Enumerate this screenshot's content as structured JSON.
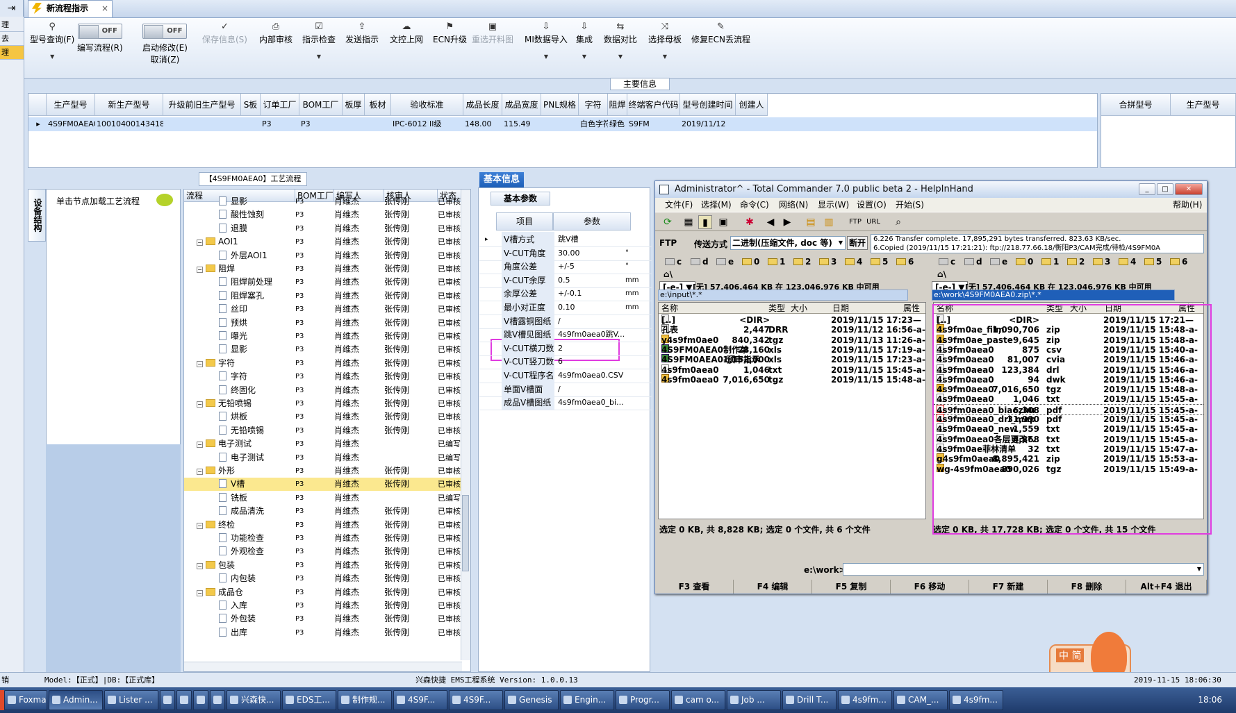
{
  "tab_title": "新流程指示",
  "toolbar": {
    "query": "型号查询(F)",
    "write": "编写流程(R)",
    "start": "启动修改(E)",
    "cancel": "取消(Z)",
    "off1": "OFF",
    "off2": "OFF",
    "save": "保存信息(S)",
    "review": "内部审核",
    "check": "指示检查",
    "send": "发送指示",
    "upload": "文控上网",
    "ecn": "ECN升级",
    "reselect": "重选开料图",
    "mi_import": "MI数据导入",
    "integrate": "集成",
    "compare": "数据对比",
    "select_board": "选择母板",
    "fix_ecn": "修复ECN丢流程"
  },
  "main_info_label": "主要信息",
  "top_grid": {
    "headers": [
      "生产型号",
      "新生产型号",
      "升级前旧生产型号",
      "S板",
      "订单工厂",
      "BOM工厂",
      "板厚",
      "板材",
      "验收标准",
      "成品长度",
      "成品宽度",
      "PNL规格",
      "字符",
      "阻焊",
      "终端客户代码",
      "型号创建时间",
      "创建人"
    ],
    "row": [
      "4S9FM0AEA0",
      "10010400143418",
      "",
      "",
      "P3",
      "P3",
      "",
      "",
      "IPC-6012 II级",
      "148.00",
      "115.49",
      "",
      "白色字符",
      "绿色",
      "S9FM",
      "2019/11/12",
      ""
    ],
    "right_headers": [
      "合拼型号",
      "生产型号"
    ]
  },
  "left_panel": {
    "vtab": "设备结构",
    "hint": "单击节点加载工艺流程"
  },
  "proc_title": "【4S9FM0AEA0】工艺流程",
  "tree": {
    "headers": [
      "流程",
      "BOM工厂",
      "编写人",
      "核审人",
      "状态"
    ],
    "rows": [
      {
        "lvl": 2,
        "t": "显影",
        "f": "P3",
        "w": "肖维杰",
        "r": "张传刚",
        "s": "已审核"
      },
      {
        "lvl": 2,
        "t": "酸性蚀刻",
        "f": "P3",
        "w": "肖维杰",
        "r": "张传刚",
        "s": "已审核"
      },
      {
        "lvl": 2,
        "t": "退膜",
        "f": "P3",
        "w": "肖维杰",
        "r": "张传刚",
        "s": "已审核"
      },
      {
        "lvl": 1,
        "t": "AOI1",
        "f": "P3",
        "w": "肖维杰",
        "r": "张传刚",
        "s": "已审核"
      },
      {
        "lvl": 2,
        "t": "外层AOI1",
        "f": "P3",
        "w": "肖维杰",
        "r": "张传刚",
        "s": "已审核"
      },
      {
        "lvl": 1,
        "t": "阻焊",
        "f": "P3",
        "w": "肖维杰",
        "r": "张传刚",
        "s": "已审核"
      },
      {
        "lvl": 2,
        "t": "阻焊前处理",
        "f": "P3",
        "w": "肖维杰",
        "r": "张传刚",
        "s": "已审核"
      },
      {
        "lvl": 2,
        "t": "阻焊塞孔",
        "f": "P3",
        "w": "肖维杰",
        "r": "张传刚",
        "s": "已审核"
      },
      {
        "lvl": 2,
        "t": "丝印",
        "f": "P3",
        "w": "肖维杰",
        "r": "张传刚",
        "s": "已审核"
      },
      {
        "lvl": 2,
        "t": "预烘",
        "f": "P3",
        "w": "肖维杰",
        "r": "张传刚",
        "s": "已审核"
      },
      {
        "lvl": 2,
        "t": "曝光",
        "f": "P3",
        "w": "肖维杰",
        "r": "张传刚",
        "s": "已审核"
      },
      {
        "lvl": 2,
        "t": "显影",
        "f": "P3",
        "w": "肖维杰",
        "r": "张传刚",
        "s": "已审核"
      },
      {
        "lvl": 1,
        "t": "字符",
        "f": "P3",
        "w": "肖维杰",
        "r": "张传刚",
        "s": "已审核"
      },
      {
        "lvl": 2,
        "t": "字符",
        "f": "P3",
        "w": "肖维杰",
        "r": "张传刚",
        "s": "已审核"
      },
      {
        "lvl": 2,
        "t": "终固化",
        "f": "P3",
        "w": "肖维杰",
        "r": "张传刚",
        "s": "已审核"
      },
      {
        "lvl": 1,
        "t": "无铅喷锡",
        "f": "P3",
        "w": "肖维杰",
        "r": "张传刚",
        "s": "已审核"
      },
      {
        "lvl": 2,
        "t": "烘板",
        "f": "P3",
        "w": "肖维杰",
        "r": "张传刚",
        "s": "已审核"
      },
      {
        "lvl": 2,
        "t": "无铅喷锡",
        "f": "P3",
        "w": "肖维杰",
        "r": "张传刚",
        "s": "已审核"
      },
      {
        "lvl": 1,
        "t": "电子测试",
        "f": "P3",
        "w": "肖维杰",
        "r": "",
        "s": "已编写"
      },
      {
        "lvl": 2,
        "t": "电子测试",
        "f": "P3",
        "w": "肖维杰",
        "r": "",
        "s": "已编写"
      },
      {
        "lvl": 1,
        "t": "外形",
        "f": "P3",
        "w": "肖维杰",
        "r": "张传刚",
        "s": "已审核"
      },
      {
        "lvl": 2,
        "t": "V槽",
        "f": "P3",
        "w": "肖维杰",
        "r": "张传刚",
        "s": "已审核",
        "sel": true
      },
      {
        "lvl": 2,
        "t": "铣板",
        "f": "P3",
        "w": "肖维杰",
        "r": "",
        "s": "已编写"
      },
      {
        "lvl": 2,
        "t": "成品清洗",
        "f": "P3",
        "w": "肖维杰",
        "r": "张传刚",
        "s": "已审核"
      },
      {
        "lvl": 1,
        "t": "终检",
        "f": "P3",
        "w": "肖维杰",
        "r": "张传刚",
        "s": "已审核"
      },
      {
        "lvl": 2,
        "t": "功能检查",
        "f": "P3",
        "w": "肖维杰",
        "r": "张传刚",
        "s": "已审核"
      },
      {
        "lvl": 2,
        "t": "外观检查",
        "f": "P3",
        "w": "肖维杰",
        "r": "张传刚",
        "s": "已审核"
      },
      {
        "lvl": 1,
        "t": "包装",
        "f": "P3",
        "w": "肖维杰",
        "r": "张传刚",
        "s": "已审核"
      },
      {
        "lvl": 2,
        "t": "内包装",
        "f": "P3",
        "w": "肖维杰",
        "r": "张传刚",
        "s": "已审核"
      },
      {
        "lvl": 1,
        "t": "成品仓",
        "f": "P3",
        "w": "肖维杰",
        "r": "张传刚",
        "s": "已审核"
      },
      {
        "lvl": 2,
        "t": "入库",
        "f": "P3",
        "w": "肖维杰",
        "r": "张传刚",
        "s": "已审核"
      },
      {
        "lvl": 2,
        "t": "外包装",
        "f": "P3",
        "w": "肖维杰",
        "r": "张传刚",
        "s": "已审核"
      },
      {
        "lvl": 2,
        "t": "出库",
        "f": "P3",
        "w": "肖维杰",
        "r": "张传刚",
        "s": "已审核"
      }
    ]
  },
  "basic": {
    "tab": "基本信息",
    "sub": "基本参数",
    "h_item": "项目",
    "h_param": "参数",
    "rows": [
      {
        "k": "V槽方式",
        "v": "跳V槽",
        "u": ""
      },
      {
        "k": "V-CUT角度",
        "v": "30.00",
        "u": "°"
      },
      {
        "k": "角度公差",
        "v": "+/-5",
        "u": "°"
      },
      {
        "k": "V-CUT余厚",
        "v": "0.5",
        "u": "mm"
      },
      {
        "k": "余厚公差",
        "v": "+/-0.1",
        "u": "mm"
      },
      {
        "k": "最小对正度",
        "v": "0.10",
        "u": "mm"
      },
      {
        "k": "V槽露铜图纸",
        "v": "/",
        "u": ""
      },
      {
        "k": "跳V槽见图纸",
        "v": "4s9fm0aea0跳V...",
        "u": ""
      },
      {
        "k": "V-CUT横刀数",
        "v": "2",
        "u": ""
      },
      {
        "k": "V-CUT竖刀数",
        "v": "6",
        "u": ""
      },
      {
        "k": "V-CUT程序名",
        "v": "4s9fm0aea0.CSV",
        "u": ""
      },
      {
        "k": "单面V槽面",
        "v": "/",
        "u": ""
      },
      {
        "k": "成品V槽图纸",
        "v": "4s9fm0aea0_bi...",
        "u": ""
      }
    ]
  },
  "tc": {
    "title": "Administrator^ - Total Commander 7.0 public beta 2 - HelpInHand",
    "menu": [
      "文件(F)",
      "选择(M)",
      "命令(C)",
      "网络(N)",
      "显示(W)",
      "设置(O)",
      "开始(S)"
    ],
    "help": "帮助(H)",
    "ftp": "FTP",
    "mode_label": "传送方式",
    "mode": "二进制(压缩文件, doc 等)",
    "disconnect": "断开",
    "log1": "6.226 Transfer complete. 17,895,291 bytes transferred. 823.63 KB/sec.",
    "log2": "6.Copied (2019/11/15 17:21:21): ftp://218.77.66.18/衡阳P3/CAM完成/待检/4S9FM0A",
    "drives": [
      "c",
      "d",
      "e",
      "0",
      "1",
      "2",
      "3",
      "4",
      "5",
      "6"
    ],
    "left_drive": "[-e-]",
    "left_free": "[无] 57,406,464 KB 在 123,046,976 KB 中可用",
    "right_drive": "[-e-]",
    "right_free": "[无] 57,406,464 KB 在 123,046,976 KB 中可用",
    "left_path": "e:\\input\\*.*",
    "right_path": "e:\\work\\4S9FM0AEA0.zip\\*.*",
    "cols": [
      "名称",
      "类型",
      "大小",
      "日期",
      "属性"
    ],
    "left_files": [
      {
        "n": "[..]",
        "t": "",
        "s": "<DIR>",
        "d": "2019/11/15 17:23—",
        "i": "up"
      },
      {
        "n": "孔表",
        "t": "DRR",
        "s": "2,447",
        "d": "2019/11/12 16:56-a-",
        "i": ""
      },
      {
        "n": "y4s9fm0ae0",
        "t": "tgz",
        "s": "840,342",
        "d": "2019/11/13 11:26-a-",
        "i": "zip"
      },
      {
        "n": "4S9FM0AEA0制作单",
        "t": "xls",
        "s": "28,160",
        "d": "2019/11/15 17:19-a-",
        "i": "xls"
      },
      {
        "n": "4S9FM0AEA0-预审指示",
        "t": "xls",
        "s": "1,152,000",
        "d": "2019/11/15 17:23-a-",
        "i": "xls"
      },
      {
        "n": "4s9fm0aea0",
        "t": "txt",
        "s": "1,046",
        "d": "2019/11/15 15:45-a-",
        "i": ""
      },
      {
        "n": "4s9fm0aea0",
        "t": "tgz",
        "s": "7,016,650",
        "d": "2019/11/15 15:48-a-",
        "i": "zip"
      }
    ],
    "right_files": [
      {
        "n": "[..]",
        "t": "",
        "s": "<DIR>",
        "d": "2019/11/15 17:21—",
        "i": "up"
      },
      {
        "n": "4s9fm0ae_film",
        "t": "zip",
        "s": "1,090,706",
        "d": "2019/11/15 15:48-a-",
        "i": "zip"
      },
      {
        "n": "4s9fm0ae_paste",
        "t": "zip",
        "s": "9,645",
        "d": "2019/11/15 15:48-a-",
        "i": "zip"
      },
      {
        "n": "4s9fm0aea0",
        "t": "csv",
        "s": "875",
        "d": "2019/11/15 15:40-a-",
        "i": ""
      },
      {
        "n": "4s9fm0aea0",
        "t": "cvia",
        "s": "81,007",
        "d": "2019/11/15 15:46-a-",
        "i": ""
      },
      {
        "n": "4s9fm0aea0",
        "t": "drl",
        "s": "123,384",
        "d": "2019/11/15 15:46-a-",
        "i": ""
      },
      {
        "n": "4s9fm0aea0",
        "t": "dwk",
        "s": "94",
        "d": "2019/11/15 15:46-a-",
        "i": ""
      },
      {
        "n": "4s9fm0aea0",
        "t": "tgz",
        "s": "7,016,650",
        "d": "2019/11/15 15:48-a-",
        "i": "zip"
      },
      {
        "n": "4s9fm0aea0",
        "t": "txt",
        "s": "1,046",
        "d": "2019/11/15 15:45-a-",
        "i": ""
      },
      {
        "n": "4s9fm0aea0_biaozhu",
        "t": "pdf",
        "s": "6,308",
        "d": "2019/11/15 15:45-a-",
        "i": "pdf",
        "sel": true
      },
      {
        "n": "4s9fm0aea0_drl_map",
        "t": "pdf",
        "s": "31,990",
        "d": "2019/11/15 15:45-a-",
        "i": "pdf"
      },
      {
        "n": "4s9fm0aea0_new",
        "t": "txt",
        "s": "1,559",
        "d": "2019/11/15 15:45-a-",
        "i": ""
      },
      {
        "n": "4s9fm0aea0各层更改?.",
        "t": "txt",
        "s": "4,868",
        "d": "2019/11/15 15:45-a-",
        "i": ""
      },
      {
        "n": "4s9fm0ae菲林清单",
        "t": "txt",
        "s": "32",
        "d": "2019/11/15 15:47-a-",
        "i": ""
      },
      {
        "n": "g4s9fm0aea0",
        "t": "zip",
        "s": "8,895,421",
        "d": "2019/11/15 15:53-a-",
        "i": "zip"
      },
      {
        "n": "wg-4s9fm0aea0",
        "t": "tgz",
        "s": "890,026",
        "d": "2019/11/15 15:49-a-",
        "i": "zip"
      }
    ],
    "left_status": "选定 0 KB, 共 8,828 KB; 选定 0 个文件, 共 6 个文件",
    "right_status": "选定 0 KB, 共 17,728 KB; 选定 0 个文件, 共 15 个文件",
    "cmd_path": "e:\\work>",
    "fkeys": [
      "F3 查看",
      "F4 编辑",
      "F5 复制",
      "F6 移动",
      "F7 新建",
      "F8 删除",
      "Alt+F4 退出"
    ]
  },
  "statusbar": {
    "model": "Model:【正式】|DB:【正式库】",
    "system": "兴森快捷 EMS工程系统 Version: 1.0.0.13",
    "datetime": "2019-11-15 18:06:30",
    "left": "销"
  },
  "left_strip": [
    "理",
    "去",
    "理"
  ],
  "ime": {
    "label": "中 简"
  },
  "taskbar": {
    "items": [
      "Foxmail",
      "Admin...",
      "Lister ...",
      "",
      "",
      "",
      "",
      "兴森快...",
      "EDS工...",
      "制作规...",
      "4S9F...",
      "4S9F...",
      "Genesis",
      "Engin...",
      "Progr...",
      "cam o...",
      "Job ...",
      "Drill T...",
      "4s9fm...",
      "CAM_...",
      "4s9fm..."
    ],
    "time": "18:06"
  }
}
